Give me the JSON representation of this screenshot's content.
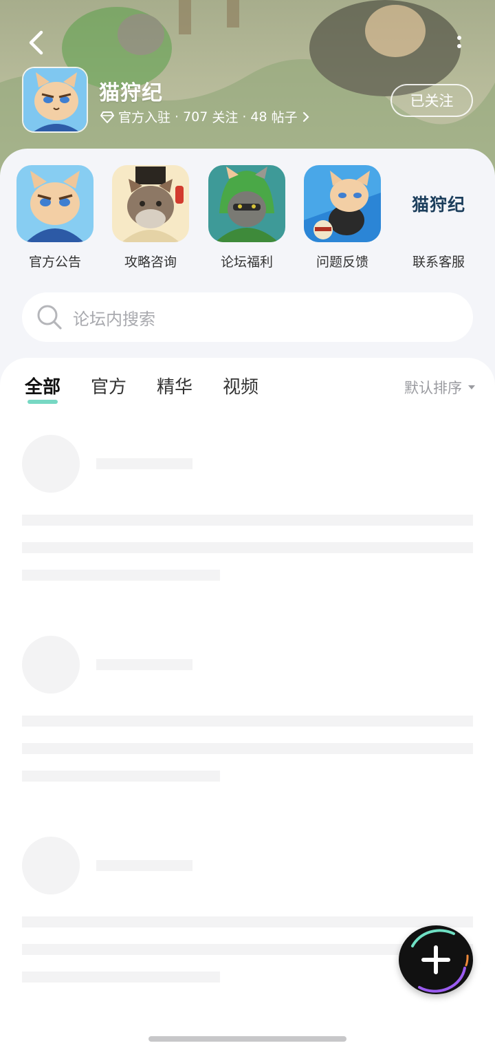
{
  "header": {
    "game_name": "猫狩纪",
    "meta": {
      "badge_text": "官方入驻",
      "followers": "707",
      "followers_label": "关注",
      "posts": "48",
      "posts_label": "帖子",
      "separator": "·"
    },
    "follow_button": "已关注",
    "back_icon": "back-arrow-icon",
    "more_icon": "more-vertical-icon"
  },
  "shortcuts": [
    {
      "label": "官方公告",
      "icon": "cat-blue-robe-icon"
    },
    {
      "label": "攻略咨询",
      "icon": "cat-scholar-icon"
    },
    {
      "label": "论坛福利",
      "icon": "cat-green-hood-icon"
    },
    {
      "label": "问题反馈",
      "icon": "cat-kick-icon"
    },
    {
      "label": "联系客服",
      "icon": "brand-logo-icon",
      "logo_text": "猫狩纪"
    }
  ],
  "search": {
    "placeholder": "论坛内搜索"
  },
  "tabs": [
    {
      "label": "全部",
      "active": true
    },
    {
      "label": "官方",
      "active": false
    },
    {
      "label": "精华",
      "active": false
    },
    {
      "label": "视频",
      "active": false
    }
  ],
  "sort": {
    "label": "默认排序",
    "icon": "caret-down-icon"
  },
  "fab": {
    "icon": "plus-icon"
  },
  "colors": {
    "accent": "#5fd1b8",
    "panel_bg": "#f4f5f9",
    "skeleton": "#f3f3f4"
  }
}
